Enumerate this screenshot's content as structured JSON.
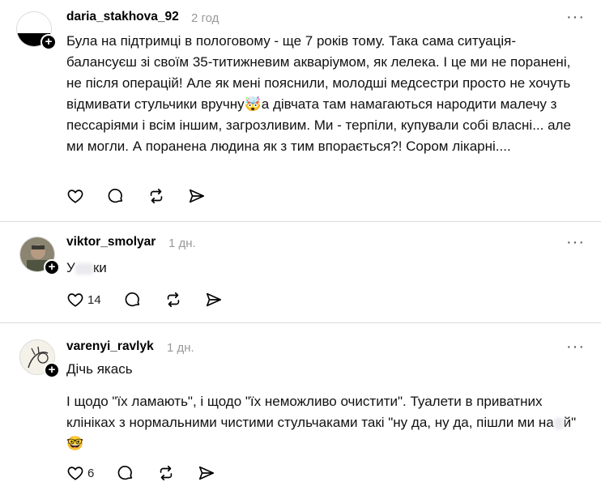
{
  "posts": [
    {
      "username": "daria_stakhova_92",
      "time": "2 год",
      "text": "Була на підтримці в пологовому - ще 7 років тому. Така сама ситуація- балансуєш зі своїм 35-титижневим акваріумом, як лелека. І це ми не поранені, не після операцій! Але як мені пояснили, молодші медсестри просто не хочуть відмивати стульчики вручну🤯а дівчата там намагаються народити малечу з пессаріями і всім іншим, загрозливим. Ми - терпіли, купували собі власні... але ми могли. А поранена людина як з тим впорається?! Сором лікарні....",
      "likes": ""
    },
    {
      "username": "viktor_smolyar",
      "time": "1 дн.",
      "text_part1": "У",
      "text_part2": "ки",
      "likes": "14"
    },
    {
      "username": "varenyi_ravlyk",
      "time": "1 дн.",
      "line1": "Дічь якась",
      "line2_a": "І щодо \"їх ламають\", і щодо \"їх неможливо очистити\". Туалети в приватних клініках з нормальними чистими стульчаками такі \"ну да, ну да, пішли ми на",
      "line2_b": "й\" 🤓",
      "likes": "6"
    }
  ],
  "more_label": "···",
  "follow_label": "+"
}
